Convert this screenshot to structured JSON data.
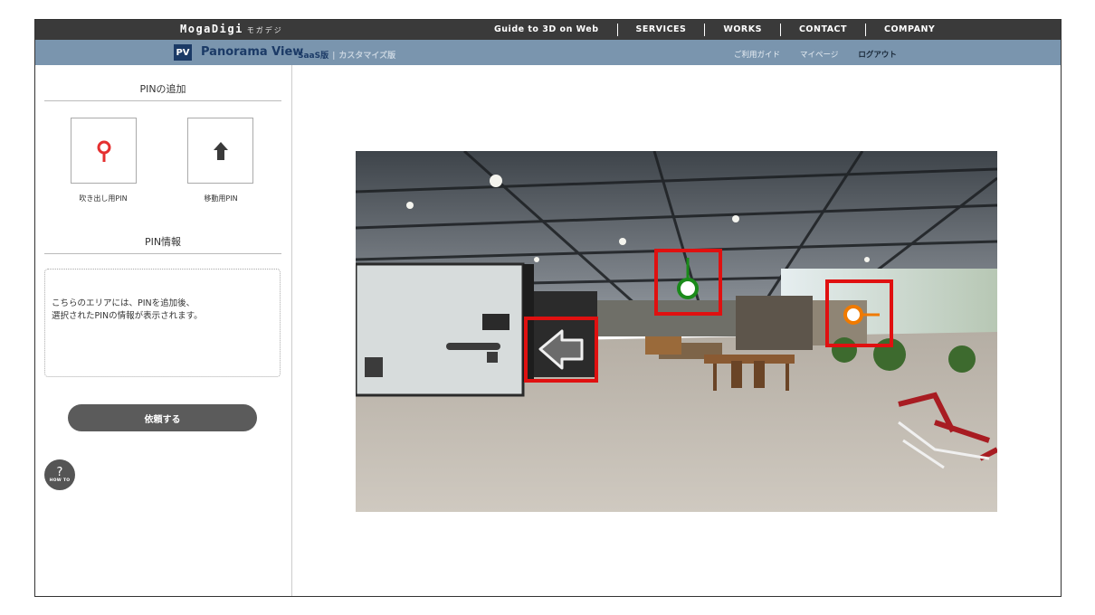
{
  "header": {
    "brand": "MogaDigi",
    "brand_kana": "モガデジ",
    "nav": [
      "Guide to 3D on Web",
      "SERVICES",
      "WORKS",
      "CONTACT",
      "COMPANY"
    ]
  },
  "subheader": {
    "badge": "PV",
    "product": "Panorama View",
    "edition": "SaaS版",
    "edition_alt": "カスタマイズ版",
    "links": [
      "ご利用ガイド",
      "マイページ",
      "ログアウト"
    ]
  },
  "sidebar": {
    "add_pin_title": "PINの追加",
    "pins": [
      {
        "label": "吹き出し用PIN",
        "icon": "map-pin-icon"
      },
      {
        "label": "移動用PIN",
        "icon": "arrow-up-icon"
      }
    ],
    "pin_info_title": "PIN情報",
    "pin_info_text": "こちらのエリアには、PINを追加後、\n選択されたPINの情報が表示されます。",
    "request_button": "依頼する",
    "howto": {
      "symbol": "?",
      "label": "HOW TO"
    }
  },
  "panorama": {
    "pins": [
      {
        "type": "move",
        "icon": "arrow-left-icon"
      },
      {
        "type": "info",
        "color": "#1a8a1a",
        "icon": "green-pin-icon"
      },
      {
        "type": "info",
        "color": "#f07a00",
        "icon": "orange-pin-icon"
      }
    ],
    "highlight_color": "#e01010"
  }
}
